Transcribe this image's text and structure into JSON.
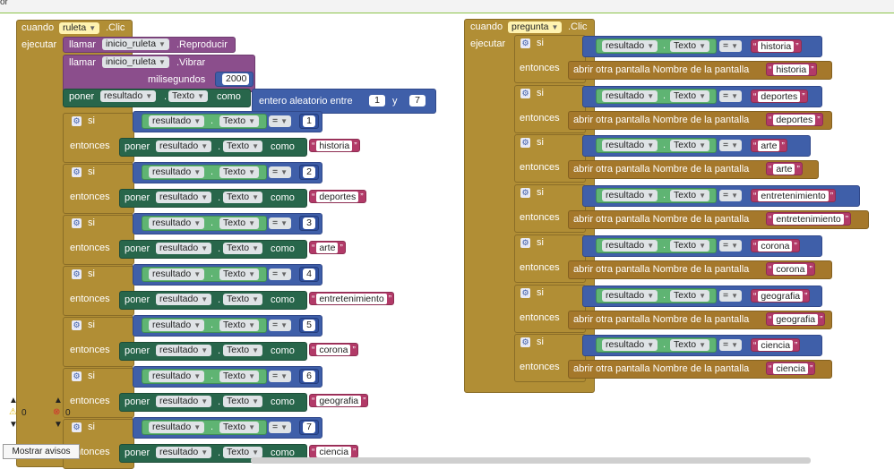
{
  "topbar": {
    "crumb": "or"
  },
  "kw": {
    "cuando": "cuando",
    "ejecutar": "ejecutar",
    "clic": ".Clic",
    "llamar": "llamar",
    "reproducir": ".Reproducir",
    "vibrar": ".Vibrar",
    "milisegundos": "milisegundos",
    "poner": "poner",
    "como": "como",
    "entero_aleatorio": "entero aleatorio entre",
    "y": "y",
    "si": "si",
    "entonces": "entonces",
    "dot": ".",
    "eq": "=",
    "abrir": "abrir otra pantalla  Nombre de la pantalla"
  },
  "left": {
    "component": "ruleta",
    "sound": "inicio_ruleta",
    "ms": "2000",
    "set_component": "resultado",
    "set_prop": "Texto",
    "rand_from": "1",
    "rand_to": "7",
    "ifs": [
      {
        "n": "1",
        "cat": "historia"
      },
      {
        "n": "2",
        "cat": "deportes"
      },
      {
        "n": "3",
        "cat": "arte"
      },
      {
        "n": "4",
        "cat": "entretenimiento"
      },
      {
        "n": "5",
        "cat": "corona"
      },
      {
        "n": "6",
        "cat": "geografia"
      },
      {
        "n": "7",
        "cat": "ciencia"
      }
    ]
  },
  "right": {
    "component": "pregunta",
    "ifs": [
      {
        "cat": "historia"
      },
      {
        "cat": "deportes"
      },
      {
        "cat": "arte"
      },
      {
        "cat": "entretenimiento"
      },
      {
        "cat": "corona"
      },
      {
        "cat": "geografia"
      },
      {
        "cat": "ciencia"
      }
    ]
  },
  "warnings": {
    "warn_count": "0",
    "error_count": "0",
    "toggle_label": "Mostrar avisos"
  },
  "colors": {
    "event": "#b18e35",
    "procedure": "#8b4e8c",
    "logic": "#3f5fa9",
    "set": "#28664b",
    "text": "#b23a68"
  }
}
